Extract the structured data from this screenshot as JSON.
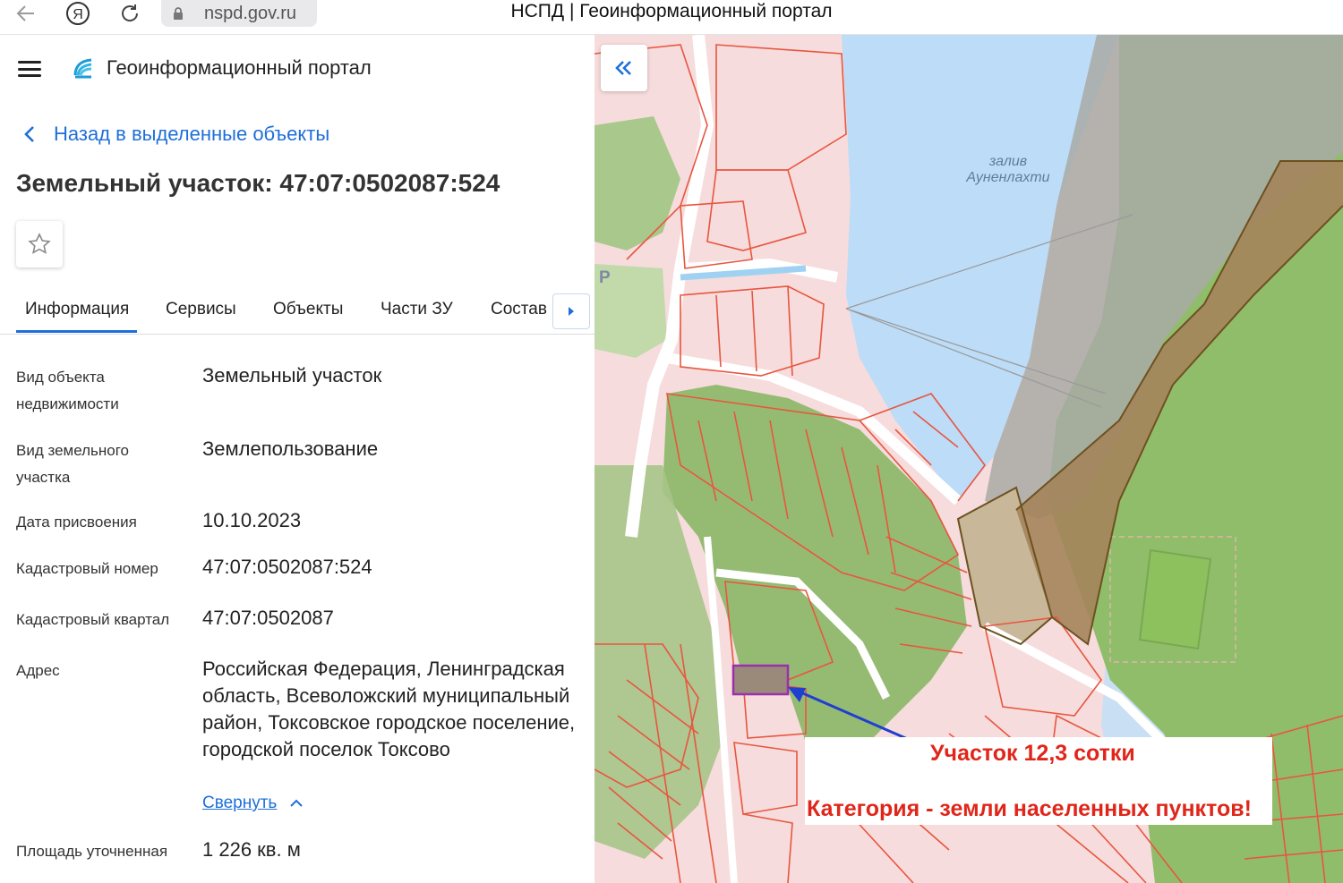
{
  "browser": {
    "url": "nspd.gov.ru",
    "title": "НСПД | Геоинформационный портал",
    "back_icon": "arrow-left-icon",
    "yandex_icon": "yandex-icon",
    "reload_icon": "reload-icon"
  },
  "header": {
    "portal_name": "Геоинформационный портал"
  },
  "back_link": "Назад в выделенные объекты",
  "object_title": "Земельный участок: 47:07:0502087:524",
  "tabs": [
    {
      "label": "Информация",
      "active": true
    },
    {
      "label": "Сервисы",
      "active": false
    },
    {
      "label": "Объекты",
      "active": false
    },
    {
      "label": "Части ЗУ",
      "active": false
    },
    {
      "label": "Состав",
      "active": false
    }
  ],
  "info_rows": [
    {
      "label": "Вид объекта недвижимости",
      "value": "Земельный участок"
    },
    {
      "label": "Вид земельного участка",
      "value": "Землепользование"
    },
    {
      "label": "Дата присвоения",
      "value": "10.10.2023"
    },
    {
      "label": "Кадастровый номер",
      "value": "47:07:0502087:524"
    },
    {
      "label": "Кадастровый квартал",
      "value": "47:07:0502087"
    },
    {
      "label": "Адрес",
      "value": "Российская Федерация, Ленинградская область, Всеволожский муниципальный район, Токсовское городское поселение, городской поселок Токсово"
    },
    {
      "label": "Площадь уточненная",
      "value": "1 226 кв. м"
    }
  ],
  "collapse_label": "Свернуть",
  "map": {
    "bay_label_1": "залив",
    "bay_label_2": "Ауненлахти",
    "parking_label": "P",
    "annotation_line1": "Участок 12,3 сотки",
    "annotation_line2": "Категория - земли населенных пунктов!"
  },
  "colors": {
    "accent": "#1e6fd9",
    "annotation_text": "#e0261a",
    "selected_parcel": "#9b2fae",
    "arrow": "#1f3fd0",
    "parcel_border": "#e8563f",
    "water": "#bcdcf7",
    "forest": "#8fbf6a"
  }
}
